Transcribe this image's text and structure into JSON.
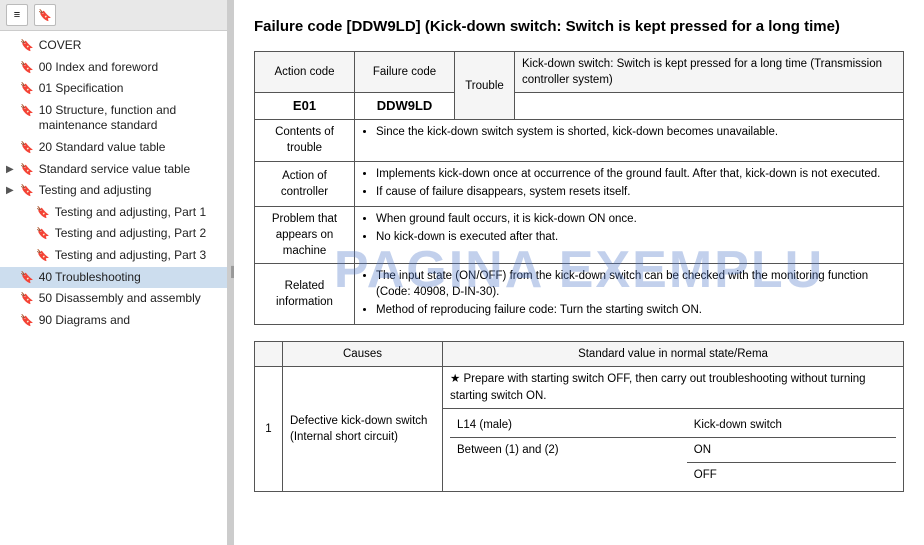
{
  "sidebar": {
    "toolbar": {
      "icon1": "≡",
      "icon2": "🔖"
    },
    "items": [
      {
        "id": "cover",
        "label": "COVER",
        "hasArrow": false,
        "level": 0
      },
      {
        "id": "index",
        "label": "00 Index and foreword",
        "hasArrow": false,
        "level": 0
      },
      {
        "id": "spec",
        "label": "01 Specification",
        "hasArrow": false,
        "level": 0
      },
      {
        "id": "structure",
        "label": "10 Structure, function and maintenance standard",
        "hasArrow": false,
        "level": 0
      },
      {
        "id": "standard-value",
        "label": "20 Standard value table",
        "hasArrow": false,
        "level": 0
      },
      {
        "id": "service-value",
        "label": "Standard service value table",
        "hasArrow": true,
        "level": 0,
        "expanded": false
      },
      {
        "id": "testing-adj",
        "label": "Testing and adjusting",
        "hasArrow": true,
        "level": 0,
        "expanded": false
      },
      {
        "id": "testing-adj-1",
        "label": "Testing and adjusting, Part 1",
        "hasArrow": false,
        "level": 1
      },
      {
        "id": "testing-adj-2",
        "label": "Testing and adjusting, Part 2",
        "hasArrow": false,
        "level": 1
      },
      {
        "id": "testing-adj-3",
        "label": "Testing and adjusting, Part 3",
        "hasArrow": false,
        "level": 1
      },
      {
        "id": "troubleshooting",
        "label": "40 Troubleshooting",
        "hasArrow": false,
        "level": 0
      },
      {
        "id": "disassembly",
        "label": "50 Disassembly and assembly",
        "hasArrow": false,
        "level": 0
      },
      {
        "id": "diagrams",
        "label": "90 Diagrams and",
        "hasArrow": false,
        "level": 0
      }
    ]
  },
  "main": {
    "title": "Failure code [DDW9LD] (Kick-down switch: Switch is kept pressed for a long time)",
    "table1": {
      "headers": [
        "Action code",
        "Failure code",
        "Trouble",
        ""
      ],
      "action_code": "E01",
      "failure_code": "DDW9LD",
      "trouble": "Trouble",
      "trouble_desc": "Kick-down switch: Switch is kept pressed for a long time (Transmission controller system)",
      "rows": [
        {
          "label": "Contents of trouble",
          "content": "Since the kick-down switch system is shorted, kick-down becomes unavailable."
        },
        {
          "label": "Action of controller",
          "content": "Implements kick-down once at occurrence of the ground fault. After that, kick-down is not executed.\nIf cause of failure disappears, system resets itself."
        },
        {
          "label": "Problem that appears on machine",
          "content": "When ground fault occurs, it is kick-down ON once.\nNo kick-down is executed after that."
        },
        {
          "label": "Related information",
          "content_lines": [
            "The input state (ON/OFF) from the kick-down switch can be checked with the monitoring function (Code: 40908, D-IN-30).",
            "Method of reproducing failure code: Turn the starting switch ON."
          ]
        }
      ]
    },
    "table2": {
      "headers": [
        "",
        "Causes",
        "Standard value in normal state/Rema"
      ],
      "rows": [
        {
          "num": "1",
          "cause": "Defective kick-down switch (Internal short circuit)",
          "sub_rows": [
            {
              "prep": "★ Prepare with starting switch OFF, then carry out troubleshooting without turning starting switch ON.",
              "connector": "L14 (male)",
              "measure": "Kick-down switch",
              "on_val": "ON",
              "off_val": "OFF"
            }
          ],
          "between": "Between (1) and (2)"
        }
      ]
    },
    "watermark": "PAGINA EXEMPLU"
  }
}
